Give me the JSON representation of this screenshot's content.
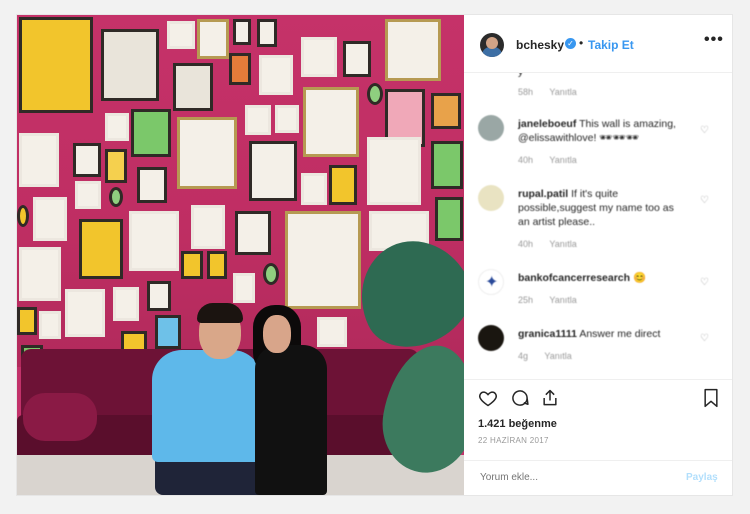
{
  "header": {
    "username": "bchesky",
    "dot": "•",
    "follow_label": "Takip Et",
    "more_label": "•••"
  },
  "comments": [
    {
      "username": "",
      "text": "",
      "time": "58h",
      "reply": "Yanıtla",
      "partial": true
    },
    {
      "username": "janeleboeuf",
      "text": "This wall is amazing, @elissawithlove! 🕶🕶🕶",
      "time": "40h",
      "reply": "Yanıtla"
    },
    {
      "username": "rupal.patil",
      "text": "If it's quite possible,suggest my name too as an artist please..",
      "time": "40h",
      "reply": "Yanıtla"
    },
    {
      "username": "bankofcancerresearch",
      "text": "😊",
      "time": "25h",
      "reply": "Yanıtla"
    },
    {
      "username": "granica1111",
      "text": "Answer me direct",
      "time": "4g",
      "reply": "Yanıtla"
    }
  ],
  "actions": {
    "like_icon": "heart-icon",
    "comment_icon": "comment-bubble-icon",
    "share_icon": "share-icon",
    "save_icon": "bookmark-icon",
    "likes": "1.421 beğenme",
    "date": "22 HAZİRAN 2017"
  },
  "comment_box": {
    "placeholder": "Yorum ekle...",
    "post_label": "Paylaş"
  },
  "colors": {
    "accent": "#3897f0",
    "wall": "#c2326a",
    "sofa": "#6d1236"
  }
}
